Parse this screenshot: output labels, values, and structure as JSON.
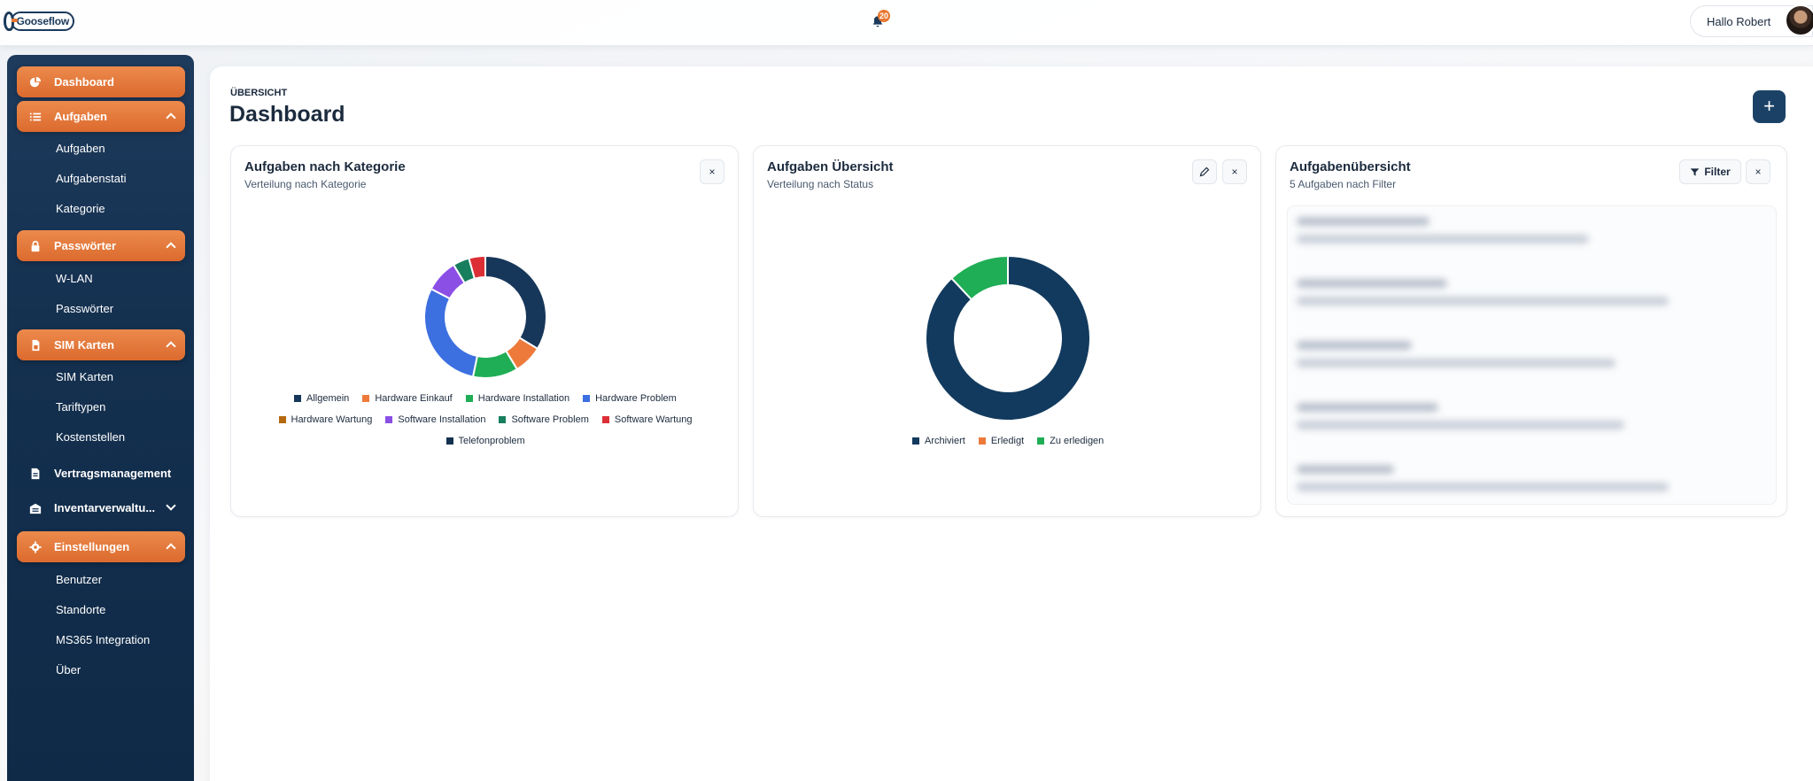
{
  "app": {
    "logo_text": "Gooseflow",
    "notifications_count": "20",
    "greeting": "Hallo Robert"
  },
  "sidebar": {
    "dashboard": "Dashboard",
    "aufgaben": {
      "label": "Aufgaben",
      "items": [
        "Aufgaben",
        "Aufgabenstati",
        "Kategorie"
      ]
    },
    "passwoerter": {
      "label": "Passwörter",
      "items": [
        "W-LAN",
        "Passwörter"
      ]
    },
    "sim": {
      "label": "SIM Karten",
      "items": [
        "SIM Karten",
        "Tariftypen",
        "Kostenstellen"
      ]
    },
    "vertrag": "Vertragsmanagement",
    "inventar": "Inventarverwaltu...",
    "einstellungen": {
      "label": "Einstellungen",
      "items": [
        "Benutzer",
        "Standorte",
        "MS365 Integration",
        "Über"
      ]
    }
  },
  "main": {
    "overline": "ÜBERSICHT",
    "title": "Dashboard",
    "add_label": "+"
  },
  "cards": {
    "category": {
      "title": "Aufgaben nach Kategorie",
      "subtitle": "Verteilung nach Kategorie",
      "close": "×"
    },
    "status": {
      "title": "Aufgaben Übersicht",
      "subtitle": "Verteilung nach Status",
      "close": "×"
    },
    "list": {
      "title": "Aufgabenübersicht",
      "subtitle": "5 Aufgaben nach Filter",
      "filter_label": "Filter",
      "close": "×"
    }
  },
  "colors": {
    "accent": "#e9772f",
    "navy": "#14304f",
    "Allgemein": "#17375a",
    "Hardware Einkauf": "#ed7a3b",
    "Hardware Installation": "#1fae55",
    "Hardware Problem": "#3c6fe0",
    "Hardware Wartung": "#b5690f",
    "Software Installation": "#8b4fe6",
    "Software Problem": "#177e5e",
    "Software Wartung": "#dc2f35",
    "Telefonproblem": "#14304f",
    "Archiviert": "#123a5e",
    "Erledigt": "#ed7a3b",
    "Zu erledigen": "#1fae55"
  },
  "chart_data": [
    {
      "type": "pie",
      "variant": "donut",
      "categories": [
        "Allgemein",
        "Hardware Einkauf",
        "Hardware Installation",
        "Hardware Problem",
        "Hardware Wartung",
        "Software Installation",
        "Software Problem",
        "Software Wartung",
        "Telefonproblem"
      ],
      "values": [
        31,
        7,
        11,
        27,
        0,
        8,
        4,
        4,
        0
      ],
      "legend_rows": [
        [
          "Allgemein",
          "Hardware Einkauf",
          "Hardware Installation",
          "Hardware Problem"
        ],
        [
          "Hardware Wartung",
          "Software Installation",
          "Software Problem",
          "Software Wartung"
        ],
        [
          "Telefonproblem"
        ]
      ]
    },
    {
      "type": "pie",
      "variant": "donut",
      "categories": [
        "Archiviert",
        "Erledigt",
        "Zu erledigen"
      ],
      "values": [
        88,
        0,
        12
      ],
      "legend_rows": [
        [
          "Archiviert",
          "Erledigt",
          "Zu erledigen"
        ]
      ]
    }
  ]
}
